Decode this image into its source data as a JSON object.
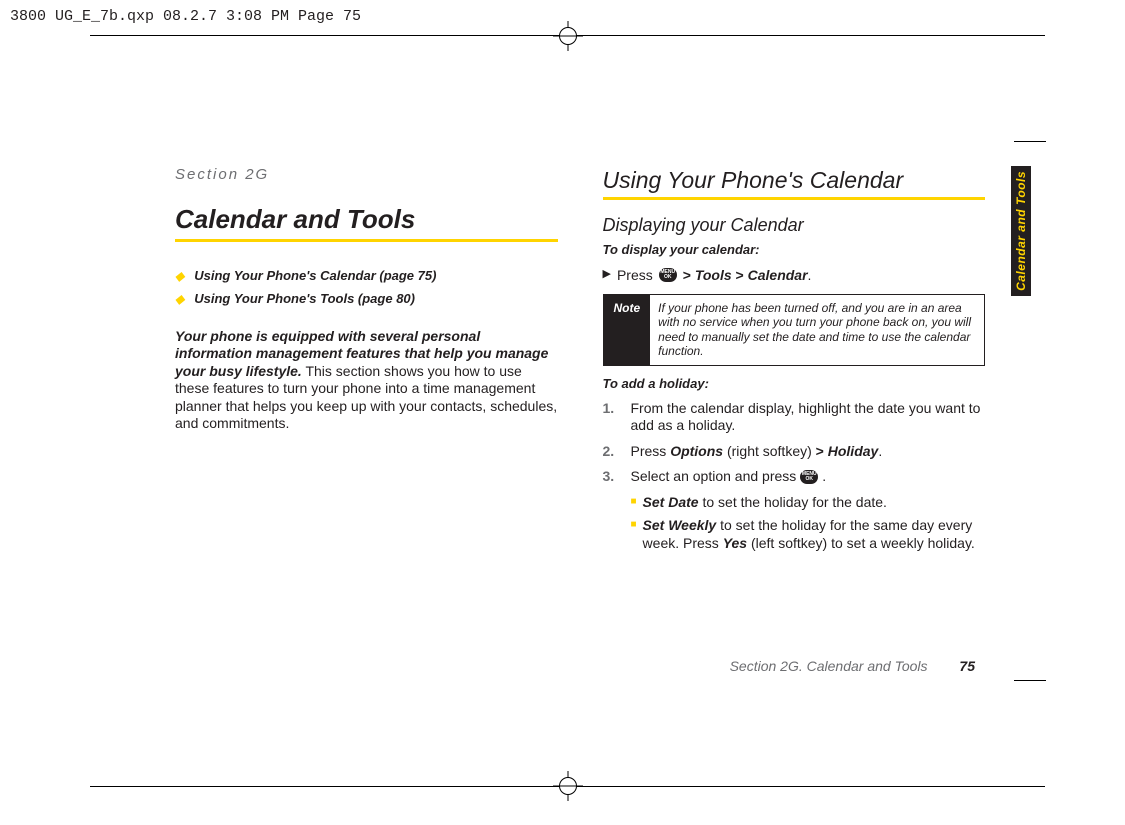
{
  "meta": {
    "crop_header": "3800 UG_E_7b.qxp  08.2.7  3:08 PM  Page 75"
  },
  "left": {
    "section_label": "Section 2G",
    "title": "Calendar and Tools",
    "toc": [
      "Using Your Phone's Calendar (page 75)",
      "Using Your Phone's Tools (page 80)"
    ],
    "intro_bold": "Your phone is equipped with several personal information management features that help you manage your busy lifestyle.",
    "intro_rest": " This section shows you how to use these features to turn your phone into a time management planner that helps you keep up with your contacts, schedules, and commitments."
  },
  "right": {
    "title": "Using Your Phone's Calendar",
    "sub1": "Displaying your Calendar",
    "lead1": "To display your calendar:",
    "press": "Press ",
    "menu_icon": "MENU OK",
    "gt": " > ",
    "tools": "Tools",
    "calendar": "Calendar",
    "period": ".",
    "note_label": "Note",
    "note_body": "If your phone has been turned off, and you are in an area with no service when you turn your phone back on, you will need to manually set the date and time to use the calendar function.",
    "lead2": "To add a holiday:",
    "steps": [
      {
        "text": "From the calendar display, highlight the date you want to add as a holiday."
      },
      {
        "pre": "Press ",
        "b1": "Options",
        "mid": " (right softkey) ",
        "gt": ">",
        "b2": " Holiday",
        "post": "."
      },
      {
        "pre": "Select an option and press ",
        "icon": true,
        "post": "."
      }
    ],
    "subitems": [
      {
        "b": "Set Date",
        "rest": " to set the holiday for the date."
      },
      {
        "b": "Set Weekly",
        "rest": " to set the holiday for the same day every week. Press ",
        "b2": "Yes",
        "rest2": " (left softkey) to set a weekly holiday."
      }
    ]
  },
  "tab": "Calendar and Tools",
  "footer": {
    "text": "Section 2G. Calendar and Tools",
    "page": "75"
  }
}
